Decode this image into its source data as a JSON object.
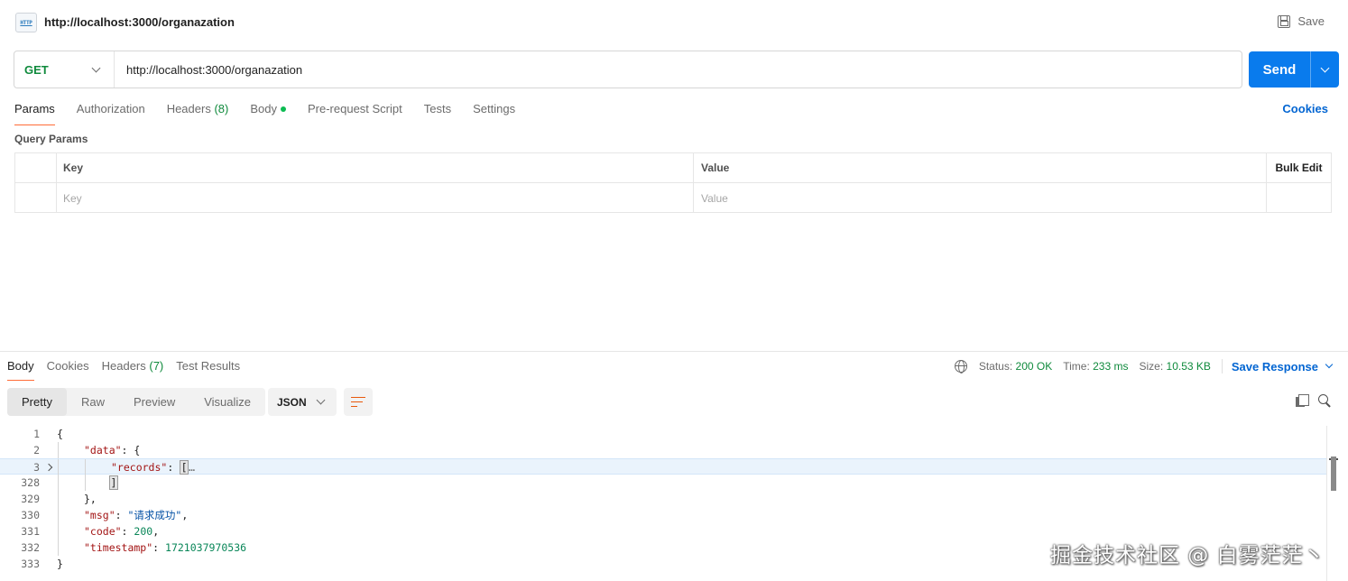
{
  "request": {
    "icon_label": "HTTP",
    "title": "http://localhost:3000/organazation",
    "save_label": "Save",
    "method": "GET",
    "url": "http://localhost:3000/organazation",
    "send_label": "Send"
  },
  "request_tabs": [
    {
      "label": "Params",
      "count": "",
      "active": true
    },
    {
      "label": "Authorization",
      "count": ""
    },
    {
      "label": "Headers",
      "count": "(8)"
    },
    {
      "label": "Body",
      "count": "",
      "dot": true
    },
    {
      "label": "Pre-request Script",
      "count": ""
    },
    {
      "label": "Tests",
      "count": ""
    },
    {
      "label": "Settings",
      "count": ""
    }
  ],
  "cookies_link": "Cookies",
  "query_params": {
    "section_label": "Query Params",
    "col_key": "Key",
    "col_value": "Value",
    "bulk_edit": "Bulk Edit",
    "key_placeholder": "Key",
    "value_placeholder": "Value"
  },
  "response_tabs": [
    {
      "label": "Body",
      "count": "",
      "active": true
    },
    {
      "label": "Cookies",
      "count": ""
    },
    {
      "label": "Headers",
      "count": "(7)"
    },
    {
      "label": "Test Results",
      "count": ""
    }
  ],
  "response_meta": {
    "status_label": "Status:",
    "status_value": "200 OK",
    "time_label": "Time:",
    "time_value": "233 ms",
    "size_label": "Size:",
    "size_value": "10.53 KB",
    "save_response": "Save Response"
  },
  "view_modes": [
    "Pretty",
    "Raw",
    "Preview",
    "Visualize"
  ],
  "active_view": "Pretty",
  "format": "JSON",
  "code_lines": [
    {
      "num": "1",
      "text": "{"
    },
    {
      "num": "2",
      "text": "\"data\": {"
    },
    {
      "num": "3",
      "text": "\"records\": […"
    },
    {
      "num": "328",
      "text": "]"
    },
    {
      "num": "329",
      "text": "},"
    },
    {
      "num": "330",
      "text": "\"msg\": \"请求成功\","
    },
    {
      "num": "331",
      "text": "\"code\": 200,"
    },
    {
      "num": "332",
      "text": "\"timestamp\": 1721037970536"
    },
    {
      "num": "333",
      "text": "}"
    }
  ],
  "watermark": "掘金技术社区 @ 白雾茫茫丶",
  "colors": {
    "accent_orange": "#ff6c37",
    "send_blue": "#097bed",
    "link_blue": "#0265d2",
    "status_green": "#0f8a3c"
  }
}
